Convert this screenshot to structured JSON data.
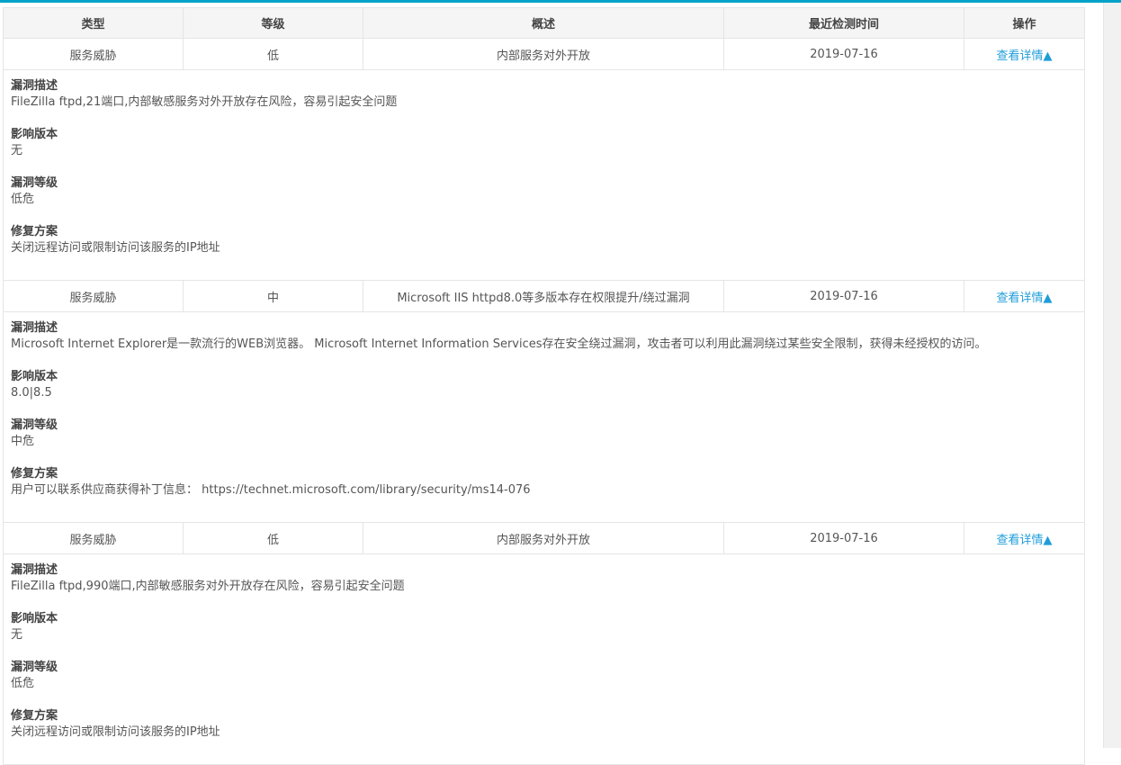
{
  "header": {
    "type": "类型",
    "level": "等级",
    "summary": "概述",
    "last_check": "最近检测时间",
    "action": "操作"
  },
  "labels": {
    "description": "漏洞描述",
    "affected": "影响版本",
    "severity": "漏洞等级",
    "fix": "修复方案"
  },
  "rows": [
    {
      "type": "服务威胁",
      "level": "低",
      "summary": "内部服务对外开放",
      "date": "2019-07-16",
      "action": "查看详情▲",
      "description": "FileZilla ftpd,21端口,内部敏感服务对外开放存在风险，容易引起安全问题",
      "affected": "无",
      "severity": "低危",
      "fix": "关闭远程访问或限制访问该服务的IP地址"
    },
    {
      "type": "服务威胁",
      "level": "中",
      "summary": "Microsoft IIS httpd8.0等多版本存在权限提升/绕过漏洞",
      "date": "2019-07-16",
      "action": "查看详情▲",
      "description": "Microsoft Internet Explorer是一款流行的WEB浏览器。 Microsoft Internet Information Services存在安全绕过漏洞，攻击者可以利用此漏洞绕过某些安全限制，获得未经授权的访问。",
      "affected": "8.0|8.5",
      "severity": "中危",
      "fix": "用户可以联系供应商获得补丁信息： https://technet.microsoft.com/library/security/ms14-076"
    },
    {
      "type": "服务威胁",
      "level": "低",
      "summary": "内部服务对外开放",
      "date": "2019-07-16",
      "action": "查看详情▲",
      "description": "FileZilla ftpd,990端口,内部敏感服务对外开放存在风险，容易引起安全问题",
      "affected": "无",
      "severity": "低危",
      "fix": "关闭远程访问或限制访问该服务的IP地址"
    }
  ],
  "colors": {
    "accent": "#00a2ca",
    "link": "#1f9dd8",
    "header_bg": "#f5f5f5",
    "border": "#e5e5e5"
  }
}
